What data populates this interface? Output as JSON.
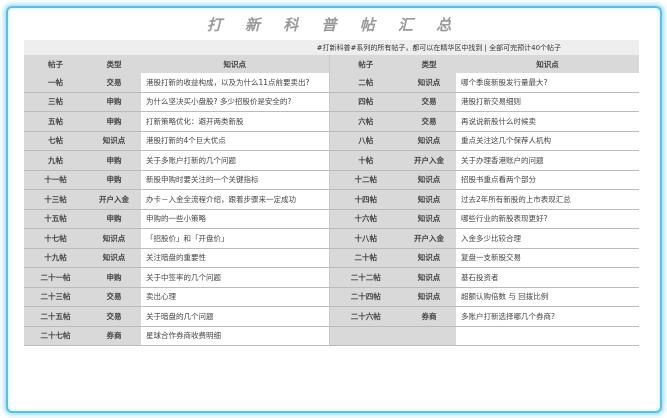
{
  "title": "打 新 科 普 帖 汇 总",
  "subtitle": "#打新科普#系列的所有帖子，都可以在精华区中找到 | 全部可完预计40个帖子",
  "headers": [
    "帖子",
    "类型",
    "知识点",
    "帖子",
    "类型",
    "知识点"
  ],
  "rows": [
    {
      "p1": "一帖",
      "t1": "交易",
      "k1": "港股打新的收益构成，以及为什么11点前要卖出?",
      "p2": "二帖",
      "t2": "知识点",
      "k2": "哪个季度新股发行量最大?"
    },
    {
      "p1": "三帖",
      "t1": "申购",
      "k1": "为什么坚决买小盘股? 多少招股价是安全的?",
      "p2": "四帖",
      "t2": "交易",
      "k2": "港股打新交易细则"
    },
    {
      "p1": "五帖",
      "t1": "申购",
      "k1": "打新策略优化：避开两类新股",
      "p2": "六帖",
      "t2": "交易",
      "k2": "再说说新股什么时候卖"
    },
    {
      "p1": "七帖",
      "t1": "知识点",
      "k1": "港股打新的4个巨大优点",
      "p2": "八帖",
      "t2": "知识点",
      "k2": "重点关注这几个保荐人机构"
    },
    {
      "p1": "九帖",
      "t1": "申购",
      "k1": "关于多账户打新的几个问题",
      "p2": "十帖",
      "t2": "开户入金",
      "k2": "关于办理香港账户的问题"
    },
    {
      "p1": "十一帖",
      "t1": "申购",
      "k1": "新股申购时要关注的一个关键指标",
      "p2": "十二帖",
      "t2": "知识点",
      "k2": "招股书重点看两个部分"
    },
    {
      "p1": "十三帖",
      "t1": "开户入金",
      "k1": "办卡－入金全流程介绍，跟着步骤来一定成功",
      "p2": "十四帖",
      "t2": "知识点",
      "k2": "过去2年所有新股的上市表现汇总"
    },
    {
      "p1": "十五帖",
      "t1": "申购",
      "k1": "申购的一些小策略",
      "p2": "十六帖",
      "t2": "知识点",
      "k2": "哪些行业的新股表现更好?"
    },
    {
      "p1": "十七帖",
      "t1": "知识点",
      "k1": "「招股价」和「开盘价」",
      "p2": "十八帖",
      "t2": "开户入金",
      "k2": "入金多少比较合理"
    },
    {
      "p1": "十九帖",
      "t1": "知识点",
      "k1": "关注暗盘的重要性",
      "p2": "二十帖",
      "t2": "知识点",
      "k2": "复盘一支新股交易"
    },
    {
      "p1": "二十一帖",
      "t1": "申购",
      "k1": "关于中签率的几个问题",
      "p2": "二十二帖",
      "t2": "知识点",
      "k2": "基石投资者"
    },
    {
      "p1": "二十三帖",
      "t1": "交易",
      "k1": "卖出心理",
      "p2": "二十四帖",
      "t2": "知识点",
      "k2": "超额认购倍数 与 回拨比例"
    },
    {
      "p1": "二十五帖",
      "t1": "交易",
      "k1": "关于暗盘的几个问题",
      "p2": "二十六帖",
      "t2": "券商",
      "k2": "多账户打新选择哪几个券商?"
    },
    {
      "p1": "二十七帖",
      "t1": "券商",
      "k1": "星球合作券商收费明细",
      "p2": "",
      "t2": "",
      "k2": ""
    }
  ]
}
